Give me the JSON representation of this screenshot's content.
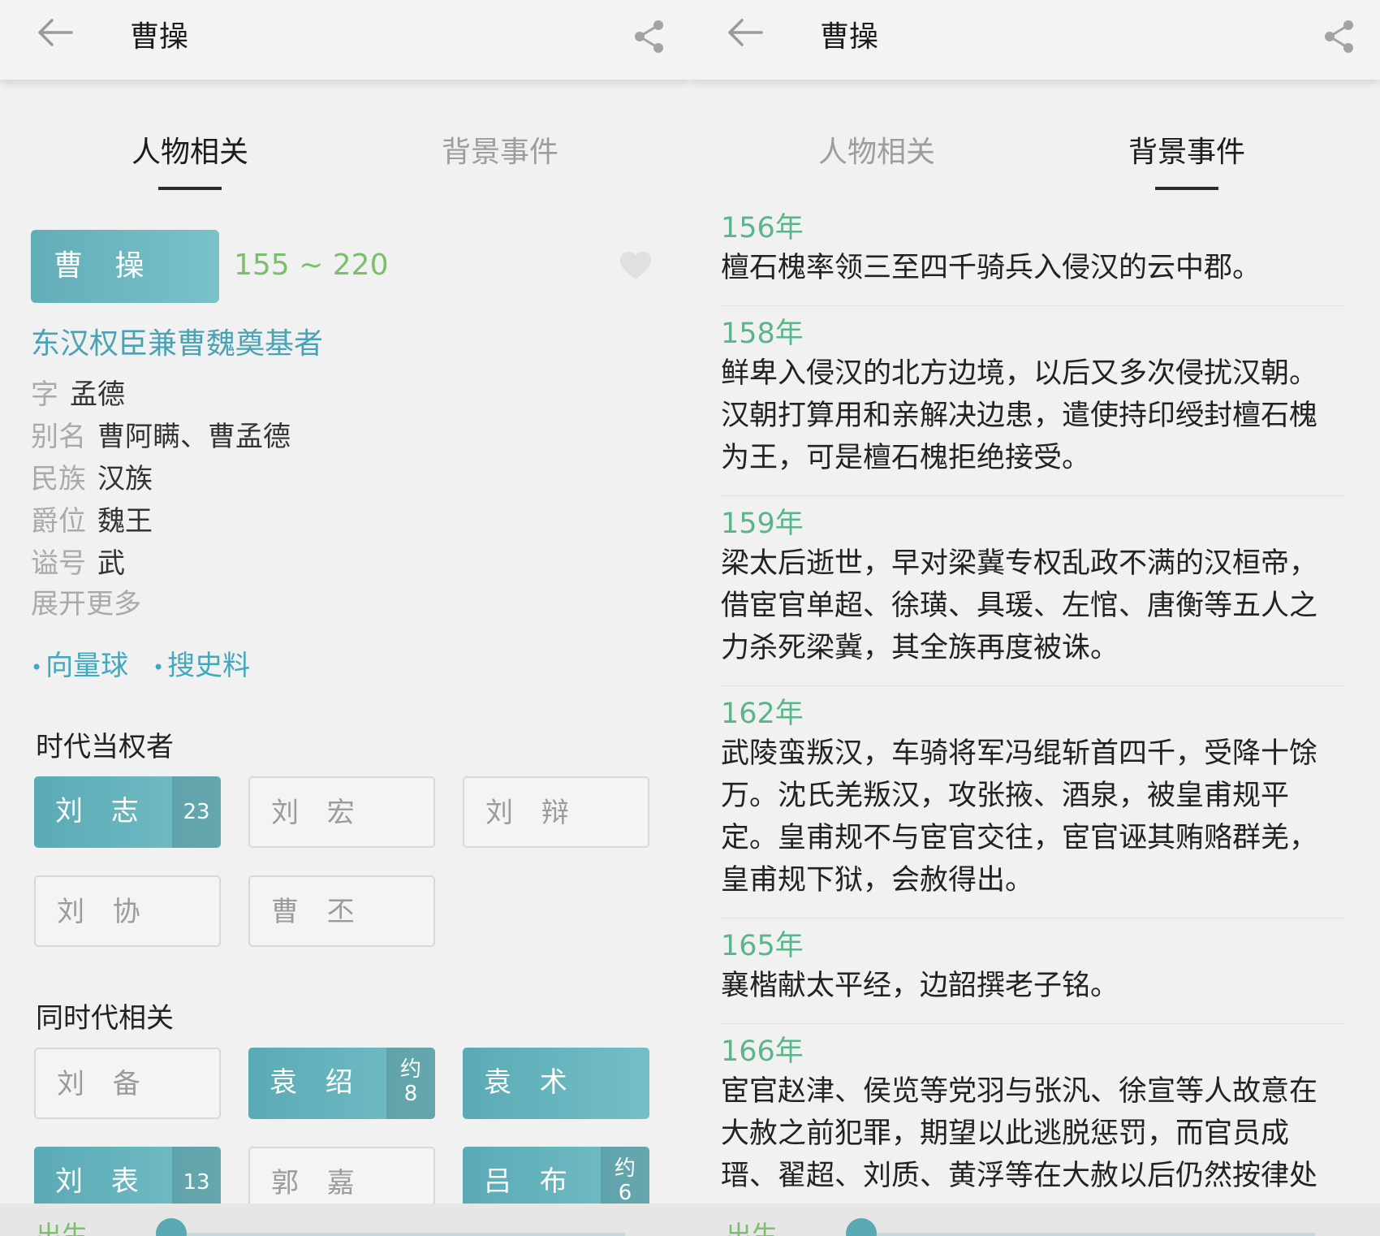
{
  "left": {
    "title": "曹操",
    "tabs": [
      {
        "label": "人物相关",
        "active": true
      },
      {
        "label": "背景事件",
        "active": false
      }
    ],
    "name": "曹 操",
    "lifespan": "155 ~ 220",
    "subtitle": "东汉权臣兼曹魏奠基者",
    "info": [
      {
        "label": "字",
        "value": "孟德"
      },
      {
        "label": "别名",
        "value": "曹阿瞒、曹孟德"
      },
      {
        "label": "民族",
        "value": "汉族"
      },
      {
        "label": "爵位",
        "value": "魏王"
      },
      {
        "label": "谥号",
        "value": "武"
      }
    ],
    "expand_label": "展开更多",
    "links": [
      "向量球",
      "搜史料"
    ],
    "section_rulers": "时代当权者",
    "rulers": [
      {
        "name": "刘 志",
        "count": "23",
        "filled": true
      },
      {
        "name": "刘 宏",
        "count": "",
        "filled": false
      },
      {
        "name": "刘 辩",
        "count": "",
        "filled": false
      },
      {
        "name": "刘 协",
        "count": "",
        "filled": false
      },
      {
        "name": "曹 丕",
        "count": "",
        "filled": false
      }
    ],
    "section_contemporaries": "同时代相关",
    "contemporaries": [
      {
        "name": "刘 备",
        "count": "",
        "filled": false
      },
      {
        "name": "袁 绍",
        "count_top": "约",
        "count_bottom": "8",
        "filled": true
      },
      {
        "name": "袁 术",
        "count": "",
        "filled": true
      },
      {
        "name": "刘 表",
        "count": "13",
        "filled": true
      },
      {
        "name": "郭 嘉",
        "count": "",
        "filled": false
      },
      {
        "name": "吕 布",
        "count_top": "约",
        "count_bottom": "6",
        "filled": true
      }
    ],
    "bottom_label": "出生"
  },
  "right": {
    "title": "曹操",
    "tabs": [
      {
        "label": "人物相关",
        "active": false
      },
      {
        "label": "背景事件",
        "active": true
      }
    ],
    "events": [
      {
        "year": "156年",
        "lines": [
          "檀石槐率领三至四千骑兵入侵汉的云中郡。"
        ]
      },
      {
        "year": "158年",
        "lines": [
          "鲜卑入侵汉的北方边境，以后又多次侵扰汉朝。",
          "汉朝打算用和亲解决边患，遣使持印绶封檀石槐",
          "为王，可是檀石槐拒绝接受。"
        ]
      },
      {
        "year": "159年",
        "lines": [
          "梁太后逝世，早对梁冀专权乱政不满的汉桓帝，",
          "借宦官单超、徐璜、具瑗、左悺、唐衡等五人之",
          "力杀死梁冀，其全族再度被诛。"
        ]
      },
      {
        "year": "162年",
        "lines": [
          "武陵蛮叛汉，车骑将军冯绲斩首四千，受降十馀",
          "万。沈氏羌叛汉，攻张掖、酒泉，被皇甫规平",
          "定。皇甫规不与宦官交往，宦官诬其贿赂群羌，",
          "皇甫规下狱，会赦得出。"
        ]
      },
      {
        "year": "165年",
        "lines": [
          "襄楷献太平经，边韶撰老子铭。"
        ]
      },
      {
        "year": "166年",
        "lines": [
          "宦官赵津、侯览等党羽与张汎、徐宣等人故意在",
          "大赦之前犯罪，期望以此逃脱惩罚，而官员成",
          "瑨、翟超、刘质、黄浮等在大赦以后仍然按律处"
        ]
      }
    ],
    "bottom_label": "出生"
  }
}
